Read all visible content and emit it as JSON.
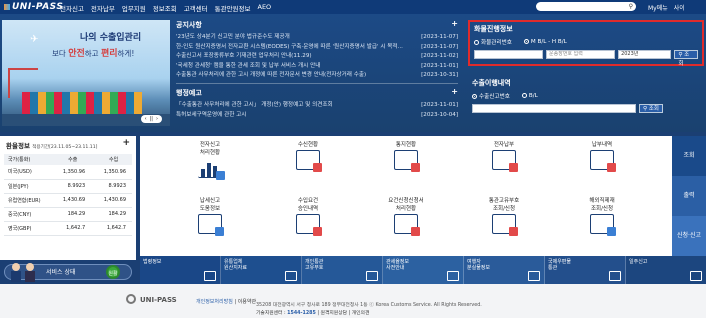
{
  "header": {
    "logo": "UNI-PASS",
    "menu": [
      "전자신고",
      "전자납부",
      "업무지원",
      "정보조회",
      "고객센터",
      "통관안원정보",
      "AEO"
    ],
    "myinfo": "My메뉴",
    "sitemap": "사이"
  },
  "banner": {
    "line1": "나의 수출입관리",
    "line2_pre": "보다",
    "line2_a": "안전",
    "line2_mid": "하고",
    "line2_b": "편리",
    "line2_post": "하게!",
    "pager": "1 / 8"
  },
  "notices": {
    "title": "공지사항",
    "items": [
      {
        "text": "'23년도 상4분기 신고민 분야 법규준수도 제공개",
        "date": "[2023-11-07]"
      },
      {
        "text": "한-인도 원산지증명서 전자교환 시스템(EODES) 구축·운영에 따른 '원산지증명서 발급' 시 목적...",
        "date": "[2023-11-07]"
      },
      {
        "text": "수출신고서 포장종류부호 기재관련 업무처리 안내(11.29)",
        "date": "[2023-11-02]"
      },
      {
        "text": "'국세청 관세청' 캠을 통한 관세 조회 및 납부 서비스 개시 안내",
        "date": "[2023-11-01]"
      },
      {
        "text": "수출통관 사무처리에 관한 고시 개정에 따른 전자문서 변경 안내(전자상거래 수출)",
        "date": "[2023-10-31]"
      }
    ]
  },
  "notices2": {
    "title": "행정예고",
    "items": [
      {
        "text": "「수출통관 사무처리에 관한 고시」 개정(안) 행정예고 및 의견조회",
        "date": "[2023-11-01]"
      },
      {
        "text": "특허보세구역운영에 관한 고시",
        "date": "[2023-10-04]"
      }
    ]
  },
  "track_cargo": {
    "title": "화물진행정보",
    "radio1": "화물관리번호",
    "radio2": "M B/L - H B/L",
    "input_placeholder": "운송장번호 입력",
    "year": "2023년",
    "button": "조회"
  },
  "track_export": {
    "title": "수출이행내역",
    "radio1": "수출신고번호",
    "radio2": "B/L",
    "button": "조회"
  },
  "exchange": {
    "title": "환율정보",
    "period": "적용기간[23.11.05~23.11.11]",
    "col_country": "국가(통화)",
    "col_import": "수출",
    "col_export": "수입",
    "rows": [
      {
        "country": "미국(USD)",
        "a": "1,350.96",
        "b": "1,350.96"
      },
      {
        "country": "일본(JPY)",
        "a": "8.9923",
        "b": "8.9923"
      },
      {
        "country": "유럽연합(EUR)",
        "a": "1,430.69",
        "b": "1,430.69"
      },
      {
        "country": "중국(CNY)",
        "a": "184.29",
        "b": "184.29"
      },
      {
        "country": "영국(GBP)",
        "a": "1,642.7",
        "b": "1,642.7"
      }
    ]
  },
  "service_status": {
    "label": "서비스 상태",
    "state": "원활"
  },
  "shortcuts": [
    {
      "l1": "전자신고",
      "l2": "처리현황"
    },
    {
      "l1": "수신현황",
      "l2": ""
    },
    {
      "l1": "통지현황",
      "l2": ""
    },
    {
      "l1": "전자납부",
      "l2": ""
    },
    {
      "l1": "납부내역",
      "l2": ""
    },
    {
      "l1": "납세신고",
      "l2": "도움정보"
    },
    {
      "l1": "수입요건",
      "l2": "승인내역"
    },
    {
      "l1": "요건신청신청서",
      "l2": "처리현황"
    },
    {
      "l1": "통관고유부호",
      "l2": "조회/신청"
    },
    {
      "l1": "해외직제재",
      "l2": "조회/신청"
    }
  ],
  "side_tabs": [
    "조회",
    "출력",
    "신청·신고"
  ],
  "bottom_links": [
    {
      "l1": "법령정보",
      "l2": ""
    },
    {
      "l1": "유통업체",
      "l2": "원산지자료"
    },
    {
      "l1": "개인통관",
      "l2": "고유부호"
    },
    {
      "l1": "관세율정보",
      "l2": "사전안내"
    },
    {
      "l1": "여행자",
      "l2": "분실물정보"
    },
    {
      "l1": "국제우편물",
      "l2": "통관"
    },
    {
      "l1": "일주신고",
      "l2": ""
    }
  ],
  "footer": {
    "logo": "UNI-PASS",
    "privacy": "개인정보처리방침",
    "terms": "이용약관",
    "address": "35208 대전광역시 서구 청사로 189 정부대전청사 1동  ⓒ Korea Customs Service. All Rights Reserved.",
    "tel_label": "기술지원센터 :",
    "tel": "1544-1285",
    "remote": "원격지원상담",
    "personal": "개인의견"
  }
}
